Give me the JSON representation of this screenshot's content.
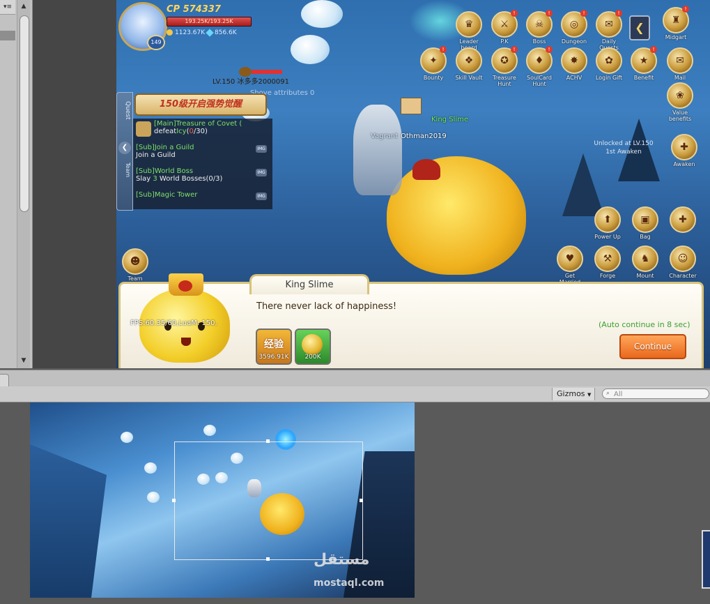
{
  "left_panel": {
    "menu_icon": "▾≡"
  },
  "hud": {
    "cp_label": "CP 574337",
    "hp_text": "193.25K/193.25K",
    "hp_fraction": 1.0,
    "gold": "1123.67K",
    "gems": "856.6K",
    "level": "149",
    "player_line": "LV.150 冰多多2000091",
    "shove_text": "Shove attributes 0",
    "unlock_line1": "Unlocked at LV.150",
    "unlock_line2": "1st Awaken"
  },
  "top_buttons": [
    {
      "label": "Leader board",
      "icon": "trophy-icon",
      "badge": ""
    },
    {
      "label": "P.K",
      "icon": "swords-icon",
      "badge": "!"
    },
    {
      "label": "Boss",
      "icon": "skull-icon",
      "badge": "!"
    },
    {
      "label": "Dungeon",
      "icon": "portal-icon",
      "badge": "!"
    },
    {
      "label": "Daily Quests",
      "icon": "scroll-icon",
      "badge": "!"
    },
    {
      "label": "Midgart",
      "icon": "castle-icon",
      "badge": "!"
    }
  ],
  "second_buttons": [
    {
      "label": "Bounty",
      "icon": "bounty-icon",
      "badge": "!"
    },
    {
      "label": "Skill Vault",
      "icon": "vault-icon",
      "badge": ""
    },
    {
      "label": "Treasure Hunt",
      "icon": "treasure-icon",
      "badge": "!"
    },
    {
      "label": "SoulCard Hunt",
      "icon": "card-icon",
      "badge": "!"
    },
    {
      "label": "ACHV",
      "icon": "medal-icon",
      "badge": ""
    },
    {
      "label": "Login Gift",
      "icon": "gift-icon",
      "badge": ""
    },
    {
      "label": "Benefit",
      "icon": "benefit-icon",
      "badge": "!"
    },
    {
      "label": "Mail",
      "icon": "mail-icon",
      "badge": ""
    }
  ],
  "side_buttons": {
    "value_benefits": "Value benefits",
    "awaken": "Awaken"
  },
  "bottom_buttons": [
    {
      "label": "Power Up",
      "icon": "powerup-icon"
    },
    {
      "label": "Bag",
      "icon": "bag-icon"
    },
    {
      "label": "",
      "icon": "dpad-icon"
    },
    {
      "label": "Get Married",
      "icon": "ring-icon"
    },
    {
      "label": "Forge",
      "icon": "anvil-icon"
    },
    {
      "label": "Mount",
      "icon": "horse-icon"
    },
    {
      "label": "Character",
      "icon": "character-icon"
    }
  ],
  "quest": {
    "tab_label": "Quest",
    "team_tab_label": "Team",
    "banner": "150级开启强势觉醒",
    "items": [
      {
        "head": "[Main]Treasure of Covet (",
        "body_prefix": "defeat",
        "body_name": "Icy",
        "count_current": "0",
        "count_total": "/30)",
        "tag": ""
      },
      {
        "head": "[Sub]Join a Guild",
        "body_prefix": "Join a Guild",
        "body_name": "",
        "count_current": "",
        "count_total": "",
        "tag": "IMG"
      },
      {
        "head": "[Sub]World Boss",
        "body_prefix": "Slay ",
        "body_name": "3",
        "count_current": " World Bosses(0",
        "count_total": "/3)",
        "tag": "IMG"
      },
      {
        "head": "[Sub]Magic Tower",
        "body_prefix": "",
        "body_name": "",
        "count_current": "",
        "count_total": "",
        "tag": "IMG"
      }
    ],
    "team_button": "Team"
  },
  "field": {
    "king_slime_tag": "King Slime",
    "vagrant_tag": "Vagrant",
    "player_name_tag": "Othman2019"
  },
  "dialog": {
    "speaker": "King Slime",
    "message": "There never lack of happiness!",
    "auto_continue": "(Auto continue in 8 sec)",
    "continue_label": "Continue",
    "fps": "FPS:60.35/60,LuaM:  150,",
    "reward_exp_label": "经验",
    "reward_exp_amount": "3596.91K",
    "reward_gold_amount": "200K"
  },
  "editor": {
    "gizmos_label": "Gizmos",
    "search_placeholder": "All"
  },
  "watermark": {
    "arabic": "مستقل",
    "latin": "mostaql.com"
  },
  "colors": {
    "accent_gold": "#d9c27a",
    "continue_orange": "#e8681c",
    "quest_green": "#7ee06a"
  }
}
